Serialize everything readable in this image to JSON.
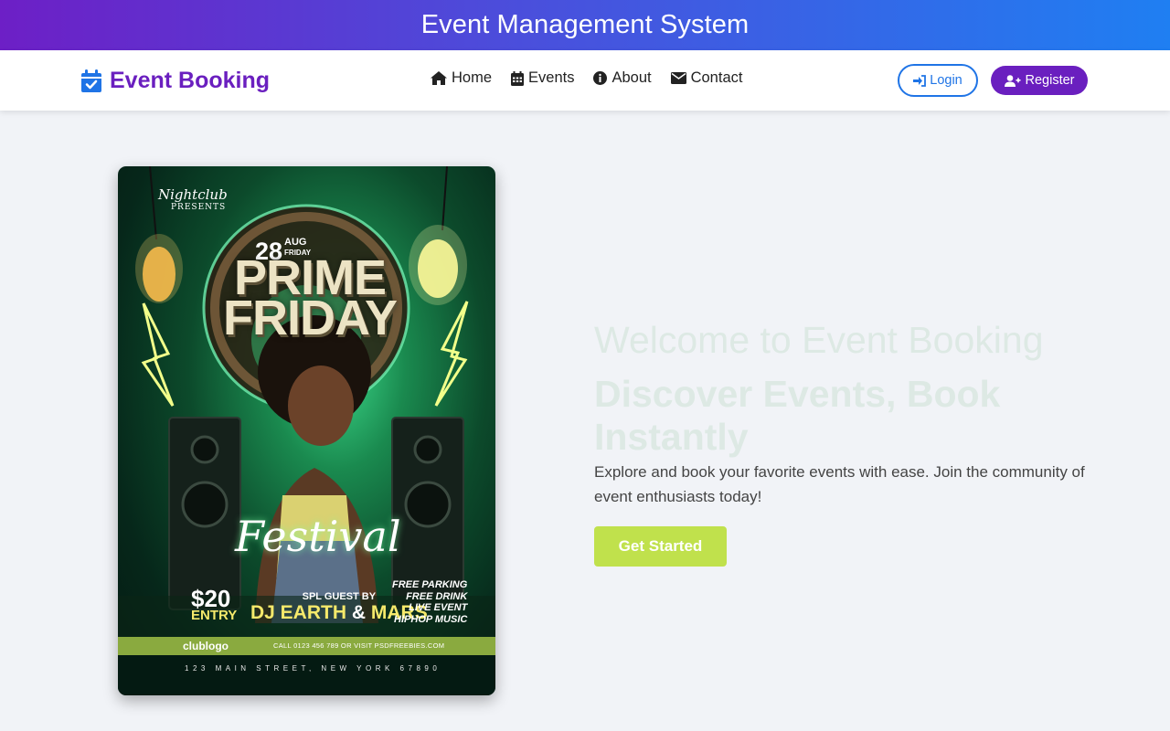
{
  "topbar": {
    "title": "Event Management System"
  },
  "brand": {
    "name": "Event Booking",
    "icon": "calendar-check-icon",
    "color": "#6a1fbf",
    "icon_color": "#1f74e6"
  },
  "nav": {
    "items": [
      {
        "label": "Home",
        "icon": "home-icon"
      },
      {
        "label": "Events",
        "icon": "calendar-icon"
      },
      {
        "label": "About",
        "icon": "info-circle-icon"
      },
      {
        "label": "Contact",
        "icon": "envelope-icon"
      }
    ]
  },
  "auth": {
    "login_label": "Login",
    "login_icon": "sign-in-icon",
    "register_label": "Register",
    "register_icon": "user-plus-icon"
  },
  "poster": {
    "presents_script": "Nightclub",
    "presents": "PRESENTS",
    "date_day": "28",
    "date_month": "AUG",
    "date_weekday": "FRIDAY",
    "title_line1": "PRIME",
    "title_line2": "FRIDAY",
    "subtitle": "Festival",
    "price": "$20",
    "price_note": "ENTRY",
    "guest_label": "SPL GUEST BY",
    "guest_dj": "DJ EARTH",
    "guest_amp": "&",
    "guest_second": "MARS",
    "perks": [
      "FREE PARKING",
      "FREE DRINK",
      "LIVE EVENT",
      "HIPHOP MUSIC"
    ],
    "club_logo": "clublogo",
    "call": "CALL 0123 456 789 OR VISIT PSDFREEBIES.COM",
    "street": "123 MAIN STREET, NEW YORK 67890"
  },
  "hero": {
    "title": "Welcome to Event Booking",
    "subtitle": "Discover Events, Book Instantly",
    "description": "Explore and book your favorite events with ease. Join the community of event enthusiasts today!",
    "cta_label": "Get Started",
    "cta_color": "#c0e14c"
  },
  "colors": {
    "gradient_start": "#6d1fc6",
    "gradient_end": "#1f7ff2",
    "page_background": "#f1f3f7"
  }
}
